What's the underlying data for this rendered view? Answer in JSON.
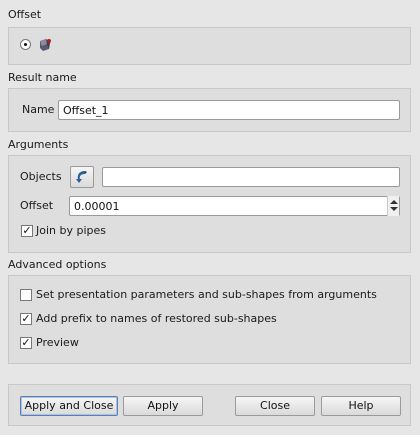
{
  "offset_section": {
    "title": "Offset",
    "mode_icon": "offset-shape-icon"
  },
  "result_section": {
    "title": "Result name",
    "name_label": "Name",
    "name_value": "Offset_1"
  },
  "arguments_section": {
    "title": "Arguments",
    "objects_label": "Objects",
    "objects_value": "",
    "select_icon": "select-arrow-icon",
    "offset_label": "Offset",
    "offset_value": "0.00001",
    "join_by_pipes_label": "Join by pipes",
    "join_by_pipes_checked": true
  },
  "advanced_section": {
    "title": "Advanced options",
    "set_presentation_label": "Set presentation parameters and sub-shapes from arguments",
    "set_presentation_checked": false,
    "add_prefix_label": "Add prefix to names of restored sub-shapes",
    "add_prefix_checked": true,
    "preview_label": "Preview",
    "preview_checked": true
  },
  "buttons": {
    "apply_and_close": "Apply and Close",
    "apply": "Apply",
    "close": "Close",
    "help": "Help"
  }
}
